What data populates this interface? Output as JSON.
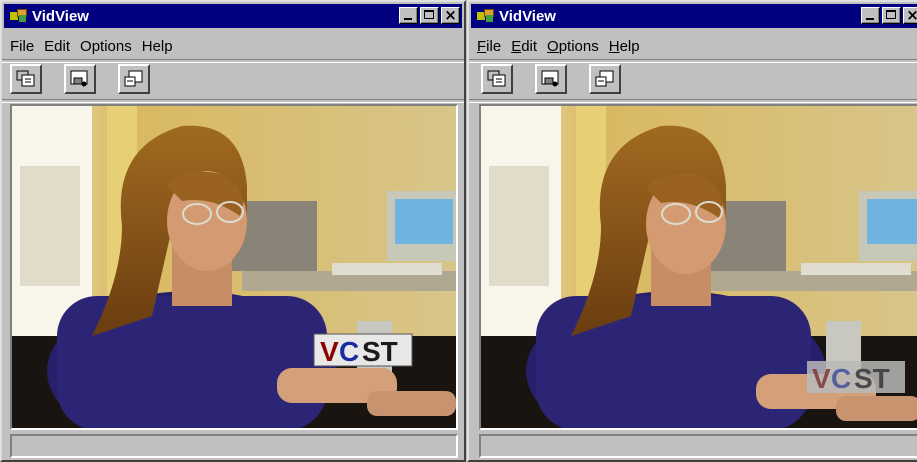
{
  "windows": [
    {
      "title": "VidView",
      "menu": [
        {
          "ul": "",
          "rest": "File"
        },
        {
          "ul": "",
          "rest": "Edit"
        },
        {
          "ul": "",
          "rest": "Options"
        },
        {
          "ul": "",
          "rest": "Help"
        }
      ],
      "toolbar": [
        "capture-frame-icon",
        "video-source-icon",
        "video-format-icon"
      ],
      "logo": {
        "v": "V",
        "c": "C",
        "st": "ST"
      },
      "status": ""
    },
    {
      "title": "VidView",
      "menu": [
        {
          "ul": "F",
          "rest": "ile"
        },
        {
          "ul": "E",
          "rest": "dit"
        },
        {
          "ul": "O",
          "rest": "ptions"
        },
        {
          "ul": "H",
          "rest": "elp"
        }
      ],
      "toolbar": [
        "capture-frame-icon",
        "video-source-icon",
        "video-format-icon"
      ],
      "logo": {
        "v": "V",
        "c": "C",
        "st": "ST"
      },
      "status": ""
    }
  ],
  "colors": {
    "titlebar": "#000080",
    "window_face": "#c0c0c0",
    "logo_v": "#8b0000",
    "logo_c": "#1a2aa0",
    "logo_st": "#1a1a1a"
  }
}
